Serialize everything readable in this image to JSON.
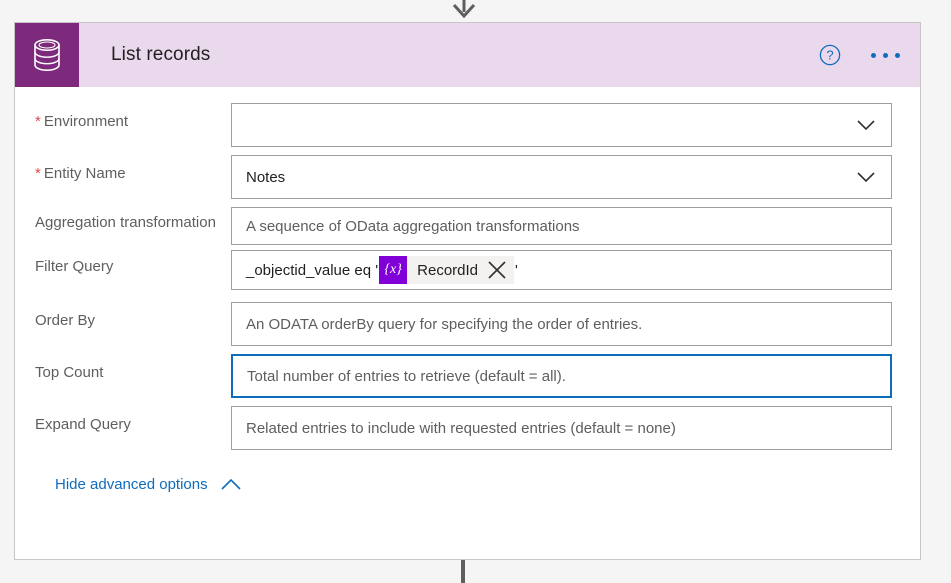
{
  "card": {
    "title": "List records",
    "icon": "database-icon",
    "header_bg": "#EAD9EC",
    "icon_bg": "#7D2A7D",
    "accent_blue": "#0F6CBD",
    "required_color": "#E04B4B",
    "help_icon": "help-circle-icon",
    "overflow_icon": "ellipsis-icon"
  },
  "fields": [
    {
      "label": "Environment",
      "required": true,
      "required_marker": "*",
      "value": "",
      "placeholder": "",
      "type": "dropdown",
      "focused": false
    },
    {
      "label": "Entity Name",
      "required": true,
      "required_marker": "*",
      "value": "Notes",
      "placeholder": "",
      "type": "dropdown",
      "focused": false
    },
    {
      "label": "Aggregation transformation",
      "required": false,
      "value": "",
      "placeholder": "A sequence of OData aggregation transformations",
      "type": "text",
      "focused": false
    },
    {
      "label": "Filter Query",
      "required": false,
      "value": "",
      "placeholder": "",
      "type": "token-text",
      "focused": false
    },
    {
      "label": "Order By",
      "required": false,
      "value": "",
      "placeholder": "An ODATA orderBy query for specifying the order of entries.",
      "type": "text",
      "focused": false
    },
    {
      "label": "Top Count",
      "required": false,
      "value": "",
      "placeholder": "Total number of entries to retrieve (default = all).",
      "type": "text",
      "focused": true
    },
    {
      "label": "Expand Query",
      "required": false,
      "value": "",
      "placeholder": "Related entries to include with requested entries (default = none)",
      "type": "text",
      "focused": false
    }
  ],
  "filter_query": {
    "prefix": "_objectid_value eq '",
    "token_badge": "{x}",
    "token_label": "RecordId",
    "token_close_icon": "close-icon",
    "suffix": "'"
  },
  "advanced_options": {
    "label": "Hide advanced options",
    "chevron": "chevron-up-icon"
  },
  "connectors": {
    "top_arrow": "arrow-down-icon",
    "bottom_line": "connector-line"
  }
}
